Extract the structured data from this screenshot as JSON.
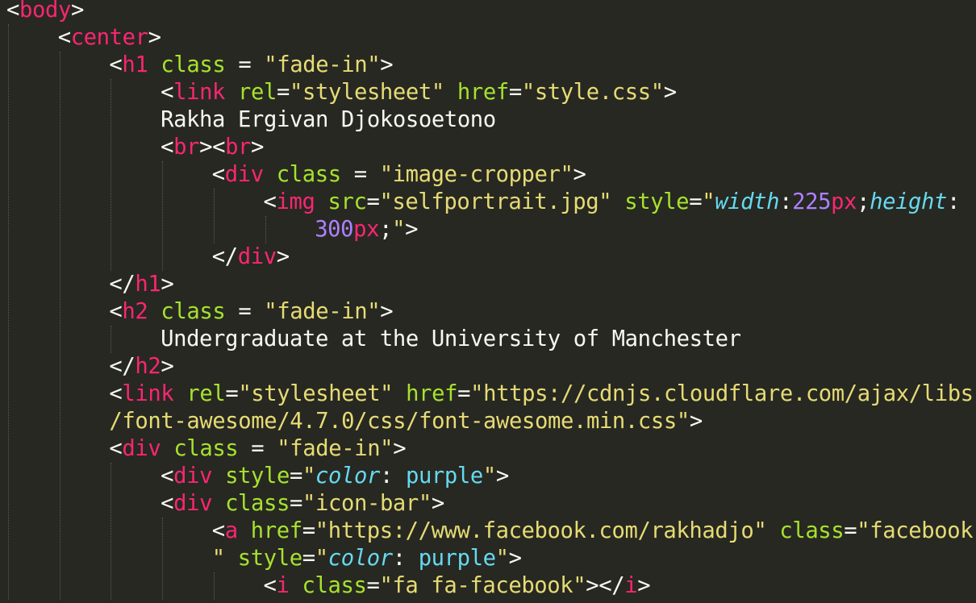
{
  "editor": {
    "theme": "monokai",
    "colors": {
      "background": "#272822",
      "tag": "#f92672",
      "attribute": "#a6e22e",
      "string": "#e6db74",
      "text": "#f8f8f2",
      "css_property": "#66d9ef",
      "number": "#ae81ff"
    },
    "lines": [
      {
        "indent": 0,
        "tokens": [
          [
            "bracket",
            "<"
          ],
          [
            "tag",
            "body"
          ],
          [
            "bracket",
            ">"
          ]
        ]
      },
      {
        "indent": 1,
        "tokens": [
          [
            "bracket",
            "<"
          ],
          [
            "tag",
            "center"
          ],
          [
            "bracket",
            ">"
          ]
        ]
      },
      {
        "indent": 2,
        "tokens": [
          [
            "bracket",
            "<"
          ],
          [
            "tag",
            "h1"
          ],
          [
            "text",
            " "
          ],
          [
            "attr",
            "class"
          ],
          [
            "op",
            " = "
          ],
          [
            "str",
            "\"fade-in\""
          ],
          [
            "bracket",
            ">"
          ]
        ]
      },
      {
        "indent": 3,
        "tokens": [
          [
            "bracket",
            "<"
          ],
          [
            "tag",
            "link"
          ],
          [
            "text",
            " "
          ],
          [
            "attr",
            "rel"
          ],
          [
            "op",
            "="
          ],
          [
            "str",
            "\"stylesheet\""
          ],
          [
            "text",
            " "
          ],
          [
            "attr",
            "href"
          ],
          [
            "op",
            "="
          ],
          [
            "str",
            "\"style.css\""
          ],
          [
            "bracket",
            ">"
          ]
        ]
      },
      {
        "indent": 3,
        "tokens": [
          [
            "text",
            "Rakha Ergivan Djokosoetono"
          ]
        ]
      },
      {
        "indent": 3,
        "tokens": [
          [
            "bracket",
            "<"
          ],
          [
            "tag",
            "br"
          ],
          [
            "bracket",
            "><"
          ],
          [
            "tag",
            "br"
          ],
          [
            "bracket",
            ">"
          ]
        ]
      },
      {
        "indent": 4,
        "tokens": [
          [
            "bracket",
            "<"
          ],
          [
            "tag",
            "div"
          ],
          [
            "text",
            " "
          ],
          [
            "attr",
            "class"
          ],
          [
            "op",
            " = "
          ],
          [
            "str",
            "\"image-cropper\""
          ],
          [
            "bracket",
            ">"
          ]
        ]
      },
      {
        "indent": 5,
        "tokens": [
          [
            "bracket",
            "<"
          ],
          [
            "tag",
            "img"
          ],
          [
            "text",
            " "
          ],
          [
            "attr",
            "src"
          ],
          [
            "op",
            "="
          ],
          [
            "str",
            "\"selfportrait.jpg\""
          ],
          [
            "text",
            " "
          ],
          [
            "attr",
            "style"
          ],
          [
            "op",
            "="
          ],
          [
            "str",
            "\""
          ],
          [
            "prop",
            "width"
          ],
          [
            "op",
            ":"
          ],
          [
            "num",
            "225"
          ],
          [
            "unit",
            "px"
          ],
          [
            "op",
            ";"
          ],
          [
            "prop",
            "height"
          ],
          [
            "op",
            ":"
          ]
        ]
      },
      {
        "indent": 6,
        "tokens": [
          [
            "num",
            "300"
          ],
          [
            "unit",
            "px"
          ],
          [
            "op",
            ";"
          ],
          [
            "str",
            "\""
          ],
          [
            "bracket",
            ">"
          ]
        ]
      },
      {
        "indent": 4,
        "tokens": [
          [
            "bracket",
            "</"
          ],
          [
            "tag",
            "div"
          ],
          [
            "bracket",
            ">"
          ]
        ]
      },
      {
        "indent": 2,
        "tokens": [
          [
            "bracket",
            "</"
          ],
          [
            "tag",
            "h1"
          ],
          [
            "bracket",
            ">"
          ]
        ]
      },
      {
        "indent": 2,
        "tokens": [
          [
            "bracket",
            "<"
          ],
          [
            "tag",
            "h2"
          ],
          [
            "text",
            " "
          ],
          [
            "attr",
            "class"
          ],
          [
            "op",
            " = "
          ],
          [
            "str",
            "\"fade-in\""
          ],
          [
            "bracket",
            ">"
          ]
        ]
      },
      {
        "indent": 3,
        "tokens": [
          [
            "text",
            "Undergraduate at the University of Manchester"
          ]
        ]
      },
      {
        "indent": 2,
        "tokens": [
          [
            "bracket",
            "</"
          ],
          [
            "tag",
            "h2"
          ],
          [
            "bracket",
            ">"
          ]
        ]
      },
      {
        "indent": 2,
        "tokens": [
          [
            "bracket",
            "<"
          ],
          [
            "tag",
            "link"
          ],
          [
            "text",
            " "
          ],
          [
            "attr",
            "rel"
          ],
          [
            "op",
            "="
          ],
          [
            "str",
            "\"stylesheet\""
          ],
          [
            "text",
            " "
          ],
          [
            "attr",
            "href"
          ],
          [
            "op",
            "="
          ],
          [
            "str",
            "\"https://cdnjs.cloudflare.com/ajax/libs"
          ]
        ]
      },
      {
        "indent": 2,
        "tokens": [
          [
            "str",
            "/font-awesome/4.7.0/css/font-awesome.min.css\""
          ],
          [
            "bracket",
            ">"
          ]
        ]
      },
      {
        "indent": 2,
        "tokens": [
          [
            "bracket",
            "<"
          ],
          [
            "tag",
            "div"
          ],
          [
            "text",
            " "
          ],
          [
            "attr",
            "class"
          ],
          [
            "op",
            " = "
          ],
          [
            "str",
            "\"fade-in\""
          ],
          [
            "bracket",
            ">"
          ]
        ]
      },
      {
        "indent": 3,
        "tokens": [
          [
            "bracket",
            "<"
          ],
          [
            "tag",
            "div"
          ],
          [
            "text",
            " "
          ],
          [
            "attr",
            "style"
          ],
          [
            "op",
            "="
          ],
          [
            "str",
            "\""
          ],
          [
            "prop",
            "color"
          ],
          [
            "op",
            ": "
          ],
          [
            "plain",
            "purple"
          ],
          [
            "str",
            "\""
          ],
          [
            "bracket",
            ">"
          ]
        ]
      },
      {
        "indent": 3,
        "tokens": [
          [
            "bracket",
            "<"
          ],
          [
            "tag",
            "div"
          ],
          [
            "text",
            " "
          ],
          [
            "attr",
            "class"
          ],
          [
            "op",
            "="
          ],
          [
            "str",
            "\"icon-bar\""
          ],
          [
            "bracket",
            ">"
          ]
        ]
      },
      {
        "indent": 4,
        "tokens": [
          [
            "bracket",
            "<"
          ],
          [
            "tag",
            "a"
          ],
          [
            "text",
            " "
          ],
          [
            "attr",
            "href"
          ],
          [
            "op",
            "="
          ],
          [
            "str",
            "\"https://www.facebook.com/rakhadjo\""
          ],
          [
            "text",
            " "
          ],
          [
            "attr",
            "class"
          ],
          [
            "op",
            "="
          ],
          [
            "str",
            "\"facebook"
          ]
        ]
      },
      {
        "indent": 4,
        "tokens": [
          [
            "str",
            "\""
          ],
          [
            "text",
            " "
          ],
          [
            "attr",
            "style"
          ],
          [
            "op",
            "="
          ],
          [
            "str",
            "\""
          ],
          [
            "prop",
            "color"
          ],
          [
            "op",
            ": "
          ],
          [
            "plain",
            "purple"
          ],
          [
            "str",
            "\""
          ],
          [
            "bracket",
            ">"
          ]
        ]
      },
      {
        "indent": 5,
        "tokens": [
          [
            "bracket",
            "<"
          ],
          [
            "tag",
            "i"
          ],
          [
            "text",
            " "
          ],
          [
            "attr",
            "class"
          ],
          [
            "op",
            "="
          ],
          [
            "str",
            "\"fa fa-facebook\""
          ],
          [
            "bracket",
            "></"
          ],
          [
            "tag",
            "i"
          ],
          [
            "bracket",
            ">"
          ]
        ]
      }
    ]
  }
}
